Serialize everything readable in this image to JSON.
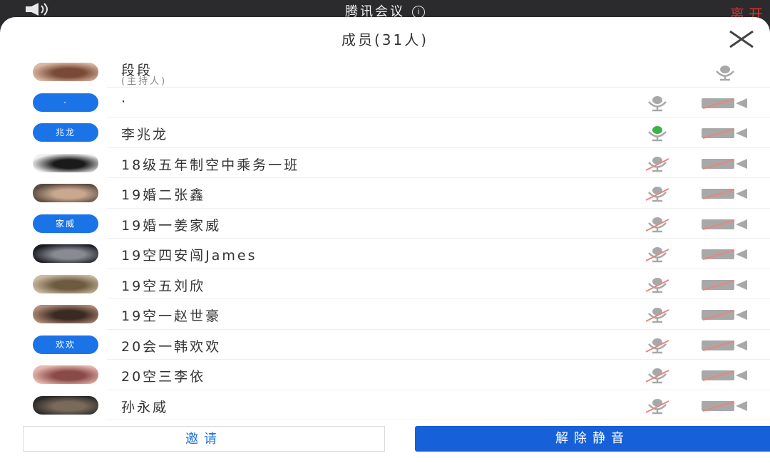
{
  "topbar": {
    "title": "腾讯会议",
    "info_glyph": "i",
    "leave_label": "离开"
  },
  "panel": {
    "title": "成员(31人)",
    "close_glyph": "✕"
  },
  "members": [
    {
      "name": "段段",
      "role": "(主持人)",
      "avatar_type": "photo",
      "avatar_text": "",
      "mic": "host-idle",
      "camera": "none"
    },
    {
      "name": "·",
      "role": "",
      "avatar_type": "text",
      "avatar_text": "·",
      "mic": "idle",
      "camera": "off"
    },
    {
      "name": "李兆龙",
      "role": "",
      "avatar_type": "text",
      "avatar_text": "兆龙",
      "mic": "active",
      "camera": "off"
    },
    {
      "name": "18级五年制空中乘务一班",
      "role": "",
      "avatar_type": "photo",
      "avatar_text": "",
      "mic": "muted",
      "camera": "off"
    },
    {
      "name": "19婚二张鑫",
      "role": "",
      "avatar_type": "photo",
      "avatar_text": "",
      "mic": "muted",
      "camera": "off"
    },
    {
      "name": "19婚一姜家威",
      "role": "",
      "avatar_type": "text",
      "avatar_text": "家威",
      "mic": "muted",
      "camera": "off"
    },
    {
      "name": "19空四安闯James",
      "role": "",
      "avatar_type": "photo",
      "avatar_text": "",
      "mic": "muted",
      "camera": "off"
    },
    {
      "name": "19空五刘欣",
      "role": "",
      "avatar_type": "photo",
      "avatar_text": "",
      "mic": "muted",
      "camera": "off"
    },
    {
      "name": "19空一赵世豪",
      "role": "",
      "avatar_type": "photo",
      "avatar_text": "",
      "mic": "muted",
      "camera": "off"
    },
    {
      "name": "20会一韩欢欢",
      "role": "",
      "avatar_type": "text",
      "avatar_text": "欢欢",
      "mic": "muted",
      "camera": "off"
    },
    {
      "name": "20空三李依",
      "role": "",
      "avatar_type": "photo",
      "avatar_text": "",
      "mic": "muted",
      "camera": "off"
    },
    {
      "name": "孙永威",
      "role": "",
      "avatar_type": "photo",
      "avatar_text": "",
      "mic": "muted",
      "camera": "off"
    }
  ],
  "footer": {
    "invite_label": "邀请",
    "unmute_label": "解除静音"
  },
  "colors": {
    "accent": "#1661d9",
    "avatar_blue": "#1b73e8",
    "leave_red": "#d9312b",
    "mic_active": "#3cb24a",
    "icon_gray": "#a8a8a8",
    "muted_slash": "#e8867e"
  },
  "icons": {
    "speaker": "speaker-icon",
    "info": "info-icon",
    "close": "close-icon",
    "mic": "microphone-icon",
    "camera": "video-camera-icon"
  }
}
